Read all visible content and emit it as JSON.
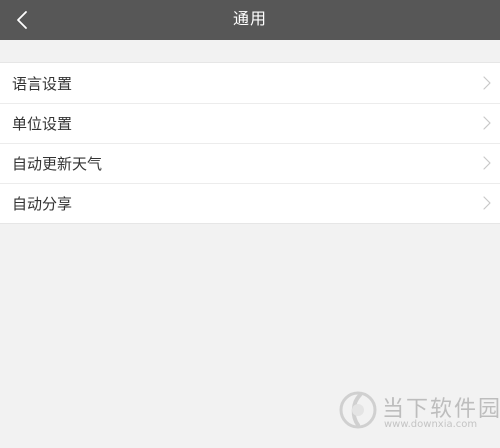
{
  "header": {
    "back_icon": "chevron-left-icon",
    "title": "通用"
  },
  "settings": {
    "items": [
      {
        "label": "语言设置",
        "icon": "chevron-right-icon"
      },
      {
        "label": "单位设置",
        "icon": "chevron-right-icon"
      },
      {
        "label": "自动更新天气",
        "icon": "chevron-right-icon"
      },
      {
        "label": "自动分享",
        "icon": "chevron-right-icon"
      }
    ]
  },
  "watermark": {
    "name": "当下软件园",
    "url": "www.downxia.com"
  },
  "colors": {
    "header_bg": "#575757",
    "page_bg": "#f2f2f2",
    "row_bg": "#ffffff",
    "text": "#333333",
    "chevron": "#c8c8c8"
  }
}
